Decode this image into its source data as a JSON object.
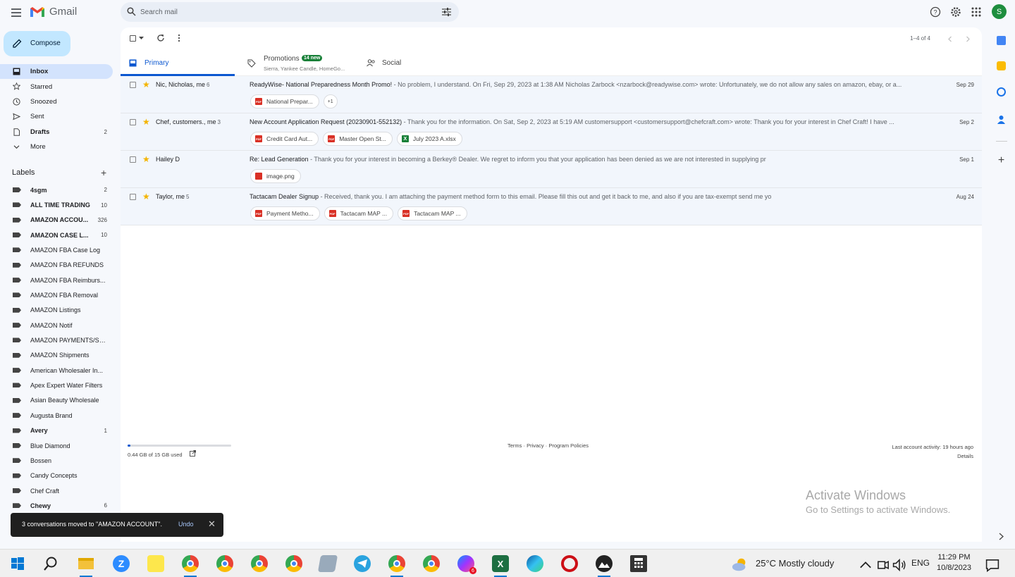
{
  "app": {
    "name": "Gmail"
  },
  "search": {
    "placeholder": "Search mail"
  },
  "account": {
    "initial": "S"
  },
  "compose": {
    "label": "Compose"
  },
  "nav": [
    {
      "label": "Inbox",
      "count": "",
      "icon": "inbox-icon"
    },
    {
      "label": "Starred",
      "count": "",
      "icon": "star-icon"
    },
    {
      "label": "Snoozed",
      "count": "",
      "icon": "clock-icon"
    },
    {
      "label": "Sent",
      "count": "",
      "icon": "send-icon"
    },
    {
      "label": "Drafts",
      "count": "2",
      "icon": "draft-icon"
    },
    {
      "label": "More",
      "count": "",
      "icon": "chevron-down-icon"
    }
  ],
  "labels_header": "Labels",
  "labels": [
    {
      "name": "4sgm",
      "count": "2",
      "bold": true
    },
    {
      "name": "ALL TIME TRADING",
      "count": "10",
      "bold": true
    },
    {
      "name": "AMAZON ACCOU...",
      "count": "326",
      "bold": true
    },
    {
      "name": "AMAZON CASE L...",
      "count": "10",
      "bold": true
    },
    {
      "name": "AMAZON FBA Case Log",
      "count": "",
      "bold": false
    },
    {
      "name": "AMAZON FBA REFUNDS",
      "count": "",
      "bold": false
    },
    {
      "name": "AMAZON FBA Reimburs...",
      "count": "",
      "bold": false
    },
    {
      "name": "AMAZON FBA Removal",
      "count": "",
      "bold": false
    },
    {
      "name": "AMAZON Listings",
      "count": "",
      "bold": false
    },
    {
      "name": "AMAZON Notif",
      "count": "",
      "bold": false
    },
    {
      "name": "AMAZON PAYMENTS/SE...",
      "count": "",
      "bold": false
    },
    {
      "name": "AMAZON Shipments",
      "count": "",
      "bold": false
    },
    {
      "name": "American Wholesaler In...",
      "count": "",
      "bold": false
    },
    {
      "name": "Apex Expert Water Filters",
      "count": "",
      "bold": false
    },
    {
      "name": "Asian Beauty Wholesale",
      "count": "",
      "bold": false
    },
    {
      "name": "Augusta Brand",
      "count": "",
      "bold": false
    },
    {
      "name": "Avery",
      "count": "1",
      "bold": true
    },
    {
      "name": "Blue Diamond",
      "count": "",
      "bold": false
    },
    {
      "name": "Bossen",
      "count": "",
      "bold": false
    },
    {
      "name": "Candy Concepts",
      "count": "",
      "bold": false
    },
    {
      "name": "Chef Craft",
      "count": "",
      "bold": false
    },
    {
      "name": "Chewy",
      "count": "6",
      "bold": true
    }
  ],
  "toolbar": {
    "pager": "1–4 of 4"
  },
  "tabs": {
    "primary": "Primary",
    "promotions": "Promotions",
    "promotions_badge": "14 new",
    "promotions_sub": "Sierra, Yankee Candle, HomeGo...",
    "social": "Social"
  },
  "emails": [
    {
      "sender": "Nic, Nicholas, me",
      "count": "6",
      "subject": "ReadyWise- National Preparedness Month Promo!",
      "preview": " - No problem, I understand. On Fri, Sep 29, 2023 at 1:38 AM Nicholas Zarbock <nzarbock@readywise.com> wrote: Unfortunately, we do not allow any sales on amazon, ebay, or a...",
      "date": "Sep 29",
      "attachments": [
        {
          "name": "National Prepar...",
          "type": "pdf"
        },
        {
          "name": "+1",
          "type": "more"
        }
      ]
    },
    {
      "sender": "Chef, customers., me",
      "count": "3",
      "subject": "New Account Application Request (20230901-552132)",
      "preview": " - Thank you for the information. On Sat, Sep 2, 2023 at 5:19 AM customersupport <customersupport@chefcraft.com> wrote: Thank you for your interest in Chef Craft! I have ...",
      "date": "Sep 2",
      "attachments": [
        {
          "name": "Credit Card Aut...",
          "type": "pdf"
        },
        {
          "name": "Master Open St...",
          "type": "pdf"
        },
        {
          "name": "July 2023 A.xlsx",
          "type": "xls"
        }
      ]
    },
    {
      "sender": "Hailey D",
      "count": "",
      "subject": "Re: Lead Generation",
      "preview": " - Thank you for your interest in becoming a Berkey® Dealer. We regret to inform you that your application has been denied as we are not interested in supplying pr",
      "date": "Sep 1",
      "attachments": [
        {
          "name": "image.png",
          "type": "img"
        }
      ]
    },
    {
      "sender": "Taylor, me",
      "count": "5",
      "subject": "Tactacam Dealer Signup",
      "preview": " - Received, thank you. I am attaching the payment method form to this email. Please fill this out and get it back to me, and also if you are tax-exempt send me yo",
      "date": "Aug 24",
      "attachments": [
        {
          "name": "Payment Metho...",
          "type": "pdf"
        },
        {
          "name": "Tactacam MAP ...",
          "type": "pdf"
        },
        {
          "name": "Tactacam MAP ...",
          "type": "pdf"
        }
      ]
    }
  ],
  "storage": {
    "text": "0.44 GB of 15 GB used",
    "fraction": 0.029
  },
  "footer": {
    "links": "Terms · Privacy · Program Policies",
    "activity": "Last account activity: 19 hours ago",
    "details": "Details"
  },
  "watermark": {
    "line1": "Activate Windows",
    "line2": "Go to Settings to activate Windows."
  },
  "snackbar": {
    "message": "3 conversations moved to \"AMAZON ACCOUNT\".",
    "action": "Undo"
  },
  "taskbar": {
    "weather": "25°C  Mostly cloudy",
    "lang": "ENG",
    "time": "11:29 PM",
    "date": "10/8/2023",
    "messenger_badge": "6"
  },
  "colors": {
    "accent": "#0b57d0",
    "compose_bg": "#c2e7ff",
    "inbox_active": "#d3e3fd",
    "star": "#f4b400",
    "promo_badge": "#188038"
  }
}
